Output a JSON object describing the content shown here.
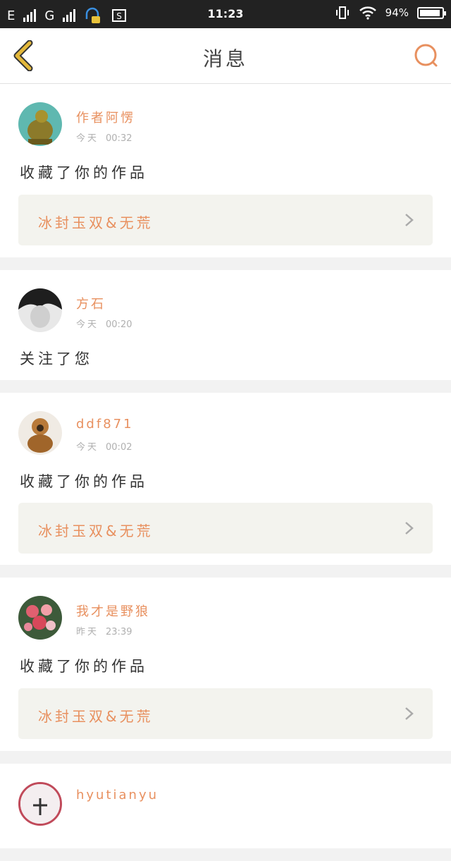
{
  "status": {
    "carrier1": "E",
    "carrier2": "G",
    "time": "11:23",
    "battery": "94%"
  },
  "header": {
    "title": "消息"
  },
  "colors": {
    "accent": "#e8905f",
    "back_arrow": "#e4b83a"
  },
  "messages": [
    {
      "user": "作者阿愣",
      "day": "今天",
      "time": "00:32",
      "action": "收藏了你的作品",
      "work": "冰封玉双&无荒"
    },
    {
      "user": "方石",
      "day": "今天",
      "time": "00:20",
      "action": "关注了您"
    },
    {
      "user": "ddf871",
      "day": "今天",
      "time": "00:02",
      "action": "收藏了你的作品",
      "work": "冰封玉双&无荒"
    },
    {
      "user": "我才是野狼",
      "day": "昨天",
      "time": "23:39",
      "action": "收藏了你的作品",
      "work": "冰封玉双&无荒"
    },
    {
      "user": "hyutianyu"
    }
  ]
}
